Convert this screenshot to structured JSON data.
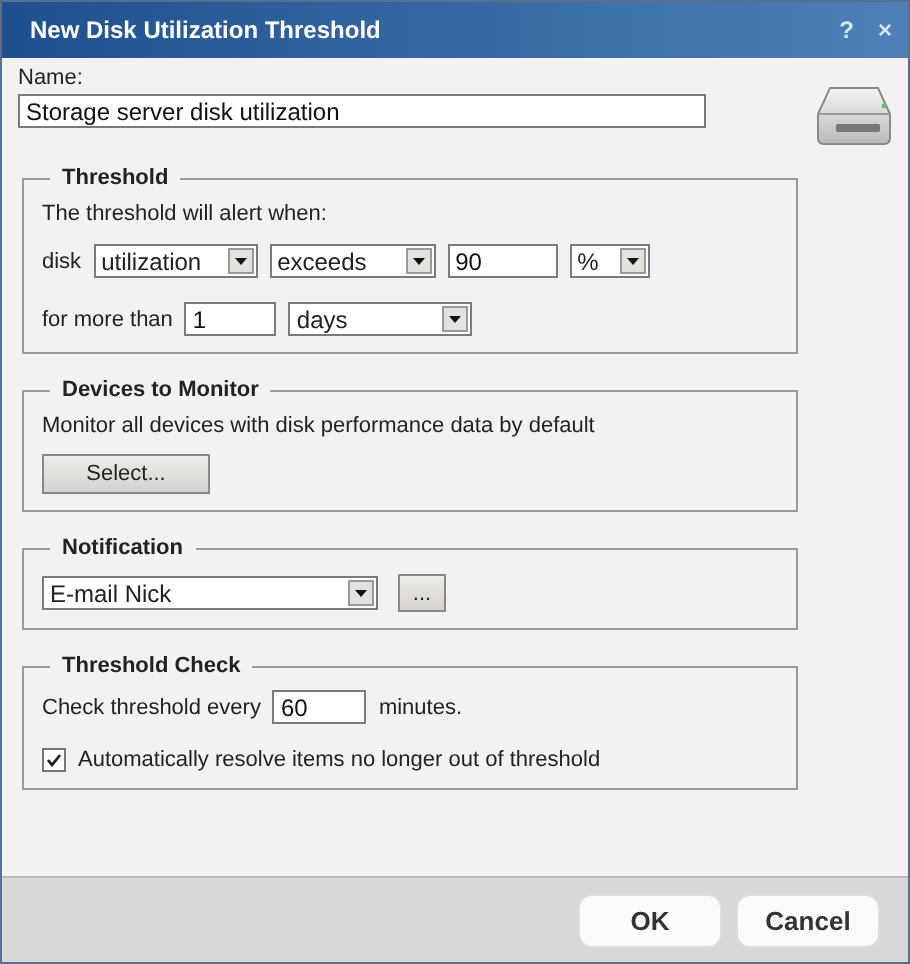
{
  "window": {
    "title": "New Disk Utilization Threshold",
    "help": "?",
    "close": "×"
  },
  "name": {
    "label": "Name:",
    "value": "Storage server disk utilization"
  },
  "threshold": {
    "legend": "Threshold",
    "intro": "The threshold will alert when:",
    "subject_label": "disk",
    "metric": "utilization",
    "operator": "exceeds",
    "value": "90",
    "unit": "%",
    "duration_label": "for more than",
    "duration": "1",
    "duration_unit": "days"
  },
  "devices": {
    "legend": "Devices to Monitor",
    "text": "Monitor all devices with disk performance data by default",
    "button": "Select..."
  },
  "notification": {
    "legend": "Notification",
    "value": "E-mail Nick",
    "button": "..."
  },
  "check": {
    "legend": "Threshold Check",
    "prefix": "Check threshold every",
    "interval": "60",
    "suffix": "minutes.",
    "auto_resolve": {
      "label": "Automatically resolve items no longer out of threshold",
      "checked": true
    }
  },
  "buttons": [
    "OK",
    "Cancel"
  ]
}
